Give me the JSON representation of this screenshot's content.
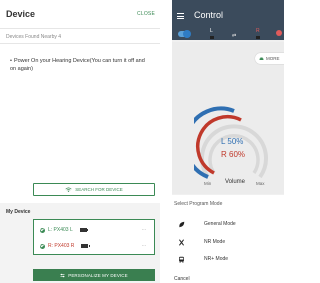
{
  "device_screen": {
    "title": "Device",
    "close_label": "CLOSE",
    "found_text": "Devices Found Nearby 4",
    "instruction": "Power On your Hearing Device(You can turn it off and on again)",
    "search_label": "SEARCH FOR DEVICE",
    "my_device_label": "My Device",
    "devices": [
      {
        "name": "L: PX403 L",
        "status_icon": "check-circle-icon",
        "battery_icon": "battery-icon",
        "more": "..."
      },
      {
        "name": "R: PX403 R",
        "status_icon": "check-circle-icon",
        "battery_icon": "battery-icon",
        "more": "..."
      }
    ],
    "personalize_label": "PERSONALIZE MY DEVICE"
  },
  "control_screen": {
    "title": "Control",
    "left_label": "L",
    "right_label": "R",
    "more_label": "MORE",
    "volume": {
      "left_text": "L 50%",
      "right_text": "R 60%",
      "left_percent": 50,
      "right_percent": 60,
      "label": "Volume",
      "min_label": "Min",
      "max_label": "Max"
    },
    "program_mode": {
      "title": "Select Program Mode",
      "options": [
        {
          "label": "General Mode",
          "icon": "leaf-icon"
        },
        {
          "label": "NR Mode",
          "icon": "utensils-icon"
        },
        {
          "label": "NR+ Mode",
          "icon": "bus-icon"
        }
      ],
      "cancel_label": "Cancel"
    }
  },
  "colors": {
    "green_accent": "#3b8a55",
    "red_accent": "#c0392b",
    "blue_accent": "#2f6fb2",
    "header_dark": "#3b4b5c"
  }
}
